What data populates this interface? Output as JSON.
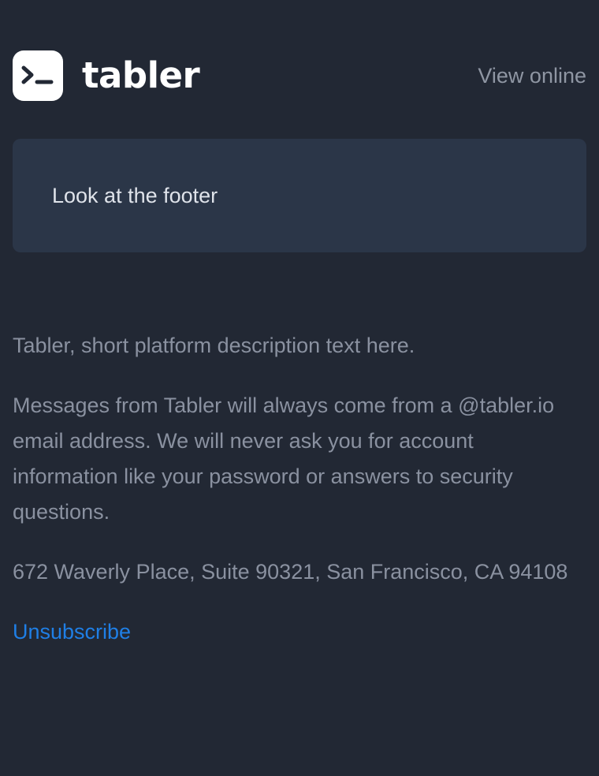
{
  "header": {
    "brand_name": "tabler",
    "logo_icon": "terminal-prompt-icon",
    "view_online_label": "View online"
  },
  "card": {
    "text": "Look at the footer"
  },
  "footer": {
    "description": "Tabler, short platform description text here.",
    "security_notice": "Messages from Tabler will always come from a @tabler.io email address. We will never ask you for account information like your password or answers to security questions.",
    "address": "672 Waverly Place, Suite 90321, San Francisco, CA 94108",
    "unsubscribe_label": "Unsubscribe"
  },
  "colors": {
    "background": "#222834",
    "card": "#2b3648",
    "link": "#1f7fe6"
  }
}
